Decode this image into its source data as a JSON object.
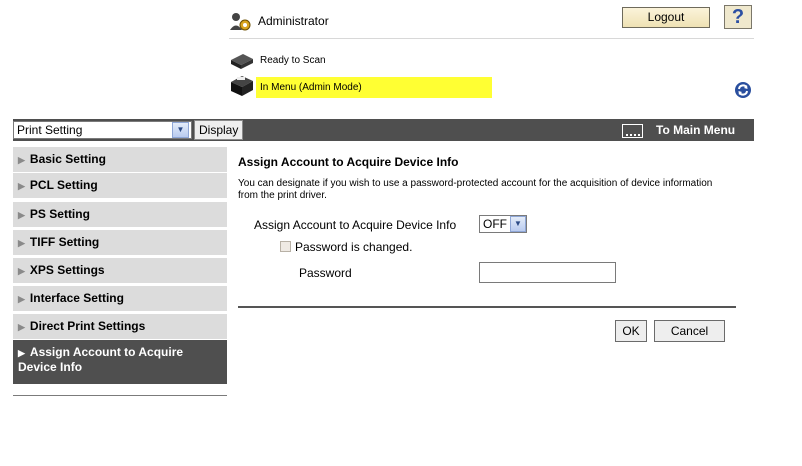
{
  "header": {
    "user_label": "Administrator",
    "logout_label": "Logout",
    "help_label": "?",
    "status_ready": "Ready to Scan",
    "status_menu": "In Menu (Admin Mode)"
  },
  "toolbar": {
    "category_select_value": "Print Setting",
    "display_label": "Display",
    "main_menu_label": "To Main Menu"
  },
  "sidebar": {
    "items": [
      {
        "label": "Basic Setting"
      },
      {
        "label": "PCL Setting"
      },
      {
        "label": "PS Setting"
      },
      {
        "label": "TIFF Setting"
      },
      {
        "label": "XPS Settings"
      },
      {
        "label": "Interface Setting"
      },
      {
        "label": "Direct Print Settings"
      }
    ],
    "active_line1": "Assign Account to Acquire",
    "active_line2": "Device Info"
  },
  "main": {
    "title": "Assign Account to Acquire Device Info",
    "description": "You can designate if you wish to use a password-protected account for the acquisition of device information from the print driver.",
    "assign_label": "Assign Account to Acquire Device Info",
    "assign_value": "OFF",
    "password_changed_label": "Password is changed.",
    "password_changed_checked": false,
    "password_label": "Password",
    "password_value": "",
    "ok_label": "OK",
    "cancel_label": "Cancel"
  },
  "colors": {
    "dark_bar": "#4f4f4f",
    "status_highlight": "#ffff33",
    "sidebar_bg": "#dcdcdc"
  }
}
